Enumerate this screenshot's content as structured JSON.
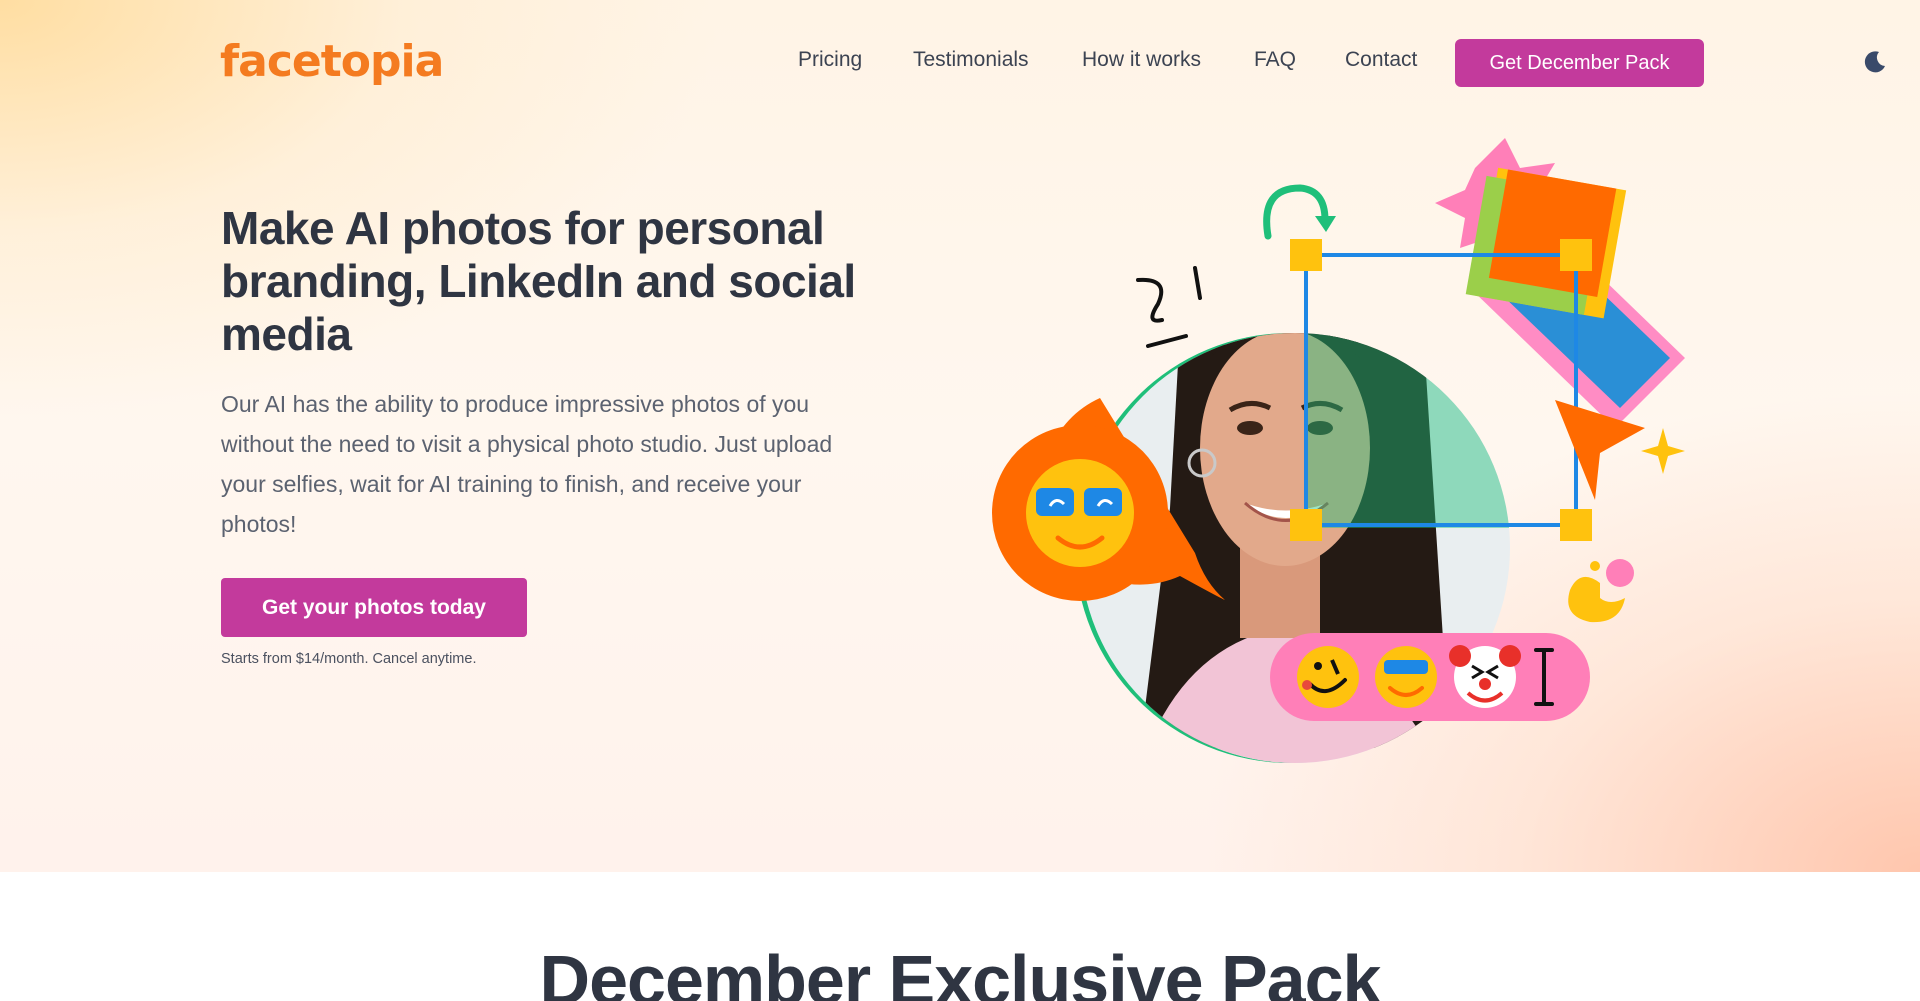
{
  "brand": {
    "name": "facetopia",
    "color": "#f47b20"
  },
  "nav": {
    "links": [
      "Pricing",
      "Testimonials",
      "How it works",
      "FAQ",
      "Contact"
    ],
    "cta_label": "Get December Pack",
    "theme_toggle_icon": "moon-icon"
  },
  "hero": {
    "headline": "Make AI photos for personal branding, LinkedIn and social media",
    "body": "Our AI has the ability to produce impressive photos of you without the need to visit a physical photo studio. Just upload your selfies, wait for AI training to finish, and receive your photos!",
    "cta_label": "Get your photos today",
    "fine_print": "Starts from $14/month. Cancel anytime.",
    "illustration_icons": [
      "rotate-arrow-icon",
      "sunglasses-emoji-icon",
      "wink-emoji-icon",
      "clown-emoji-icon",
      "text-cursor-icon",
      "pointer-arrow-icon",
      "sparkle-icon"
    ]
  },
  "next_section": {
    "title": "December Exclusive Pack"
  },
  "colors": {
    "accent": "#c33a9c",
    "heading": "#2f3542",
    "body_text": "#5b6270",
    "green": "#1fbf7a",
    "orange": "#ff6a00",
    "yellow": "#ffc20e",
    "pink": "#ff7fb8",
    "blue": "#2a8fd6"
  }
}
